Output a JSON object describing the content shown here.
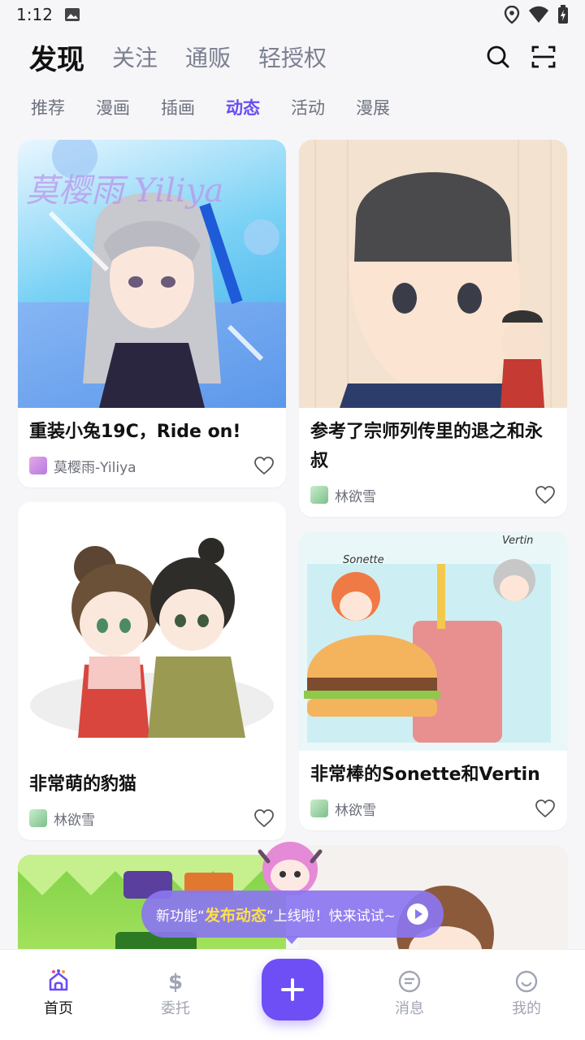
{
  "status": {
    "time": "1:12"
  },
  "top_tabs": [
    "发现",
    "关注",
    "通贩",
    "轻授权"
  ],
  "sub_tabs": [
    "推荐",
    "漫画",
    "插画",
    "动态",
    "活动",
    "漫展"
  ],
  "posts_left": [
    {
      "title": "重装小兔19C，Ride on!",
      "author": "莫樱雨-Yiliya",
      "watermark": "莫樱雨 Yiliya"
    },
    {
      "title": "非常萌的豹猫",
      "author": "林欲雪"
    }
  ],
  "posts_right": [
    {
      "title": "参考了宗师列传里的退之和永叔",
      "author": "林欲雪"
    },
    {
      "title": "非常棒的Sonette和Vertin",
      "author": "林欲雪",
      "art_labels": [
        "Sonette",
        "Vertin"
      ]
    }
  ],
  "toast": {
    "prefix": "新功能“",
    "highlight": "发布动态",
    "suffix": "”上线啦！快来试试~"
  },
  "bottom_nav": {
    "home": "首页",
    "commission": "委托",
    "messages": "消息",
    "mine": "我的"
  },
  "colors": {
    "accent": "#6e4ef5",
    "active_subtab": "#6a4cf5"
  }
}
